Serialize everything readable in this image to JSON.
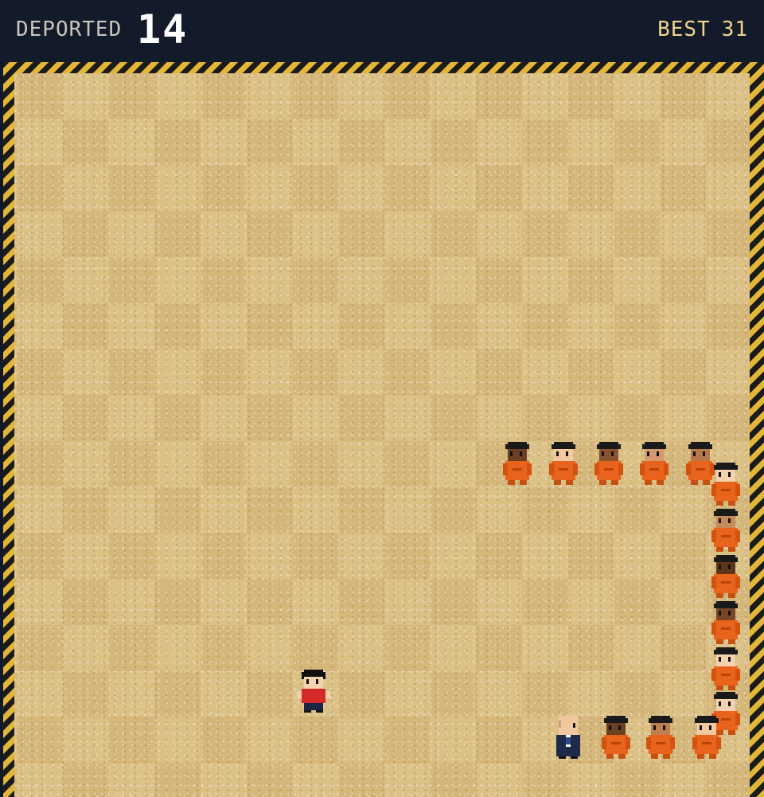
{
  "hud": {
    "score_label": "DEPORTED",
    "score_value": "14",
    "best_label": "BEST",
    "best_value": "31"
  },
  "colors": {
    "hud_bg": "#131a2a",
    "best_text": "#f1d58c",
    "hazard_yellow": "#e2b636",
    "sand_light": "#dcc187",
    "sand_dark": "#d5b77b",
    "prisoner_jumpsuit": "#e8641c",
    "player_shirt": "#d42a2a"
  },
  "game": {
    "player": {
      "name": "player-character",
      "shirt": "red"
    },
    "agent": {
      "name": "agent-in-suit",
      "hair": "bald"
    },
    "chain": [
      {
        "skin": "#6b3f22"
      },
      {
        "skin": "#f2c9a0"
      },
      {
        "skin": "#8a5330"
      },
      {
        "skin": "#d29a6c"
      },
      {
        "skin": "#b8774a"
      },
      {
        "skin": "#f4d2b0"
      },
      {
        "skin": "#c68a5a"
      },
      {
        "skin": "#5e3519"
      },
      {
        "skin": "#7a4526"
      },
      {
        "skin": "#f4d2b0"
      },
      {
        "skin": "#f4d2b0"
      },
      {
        "skin": "#f2c9a0"
      },
      {
        "skin": "#c07f4f"
      },
      {
        "skin": "#6b3f22"
      }
    ]
  }
}
